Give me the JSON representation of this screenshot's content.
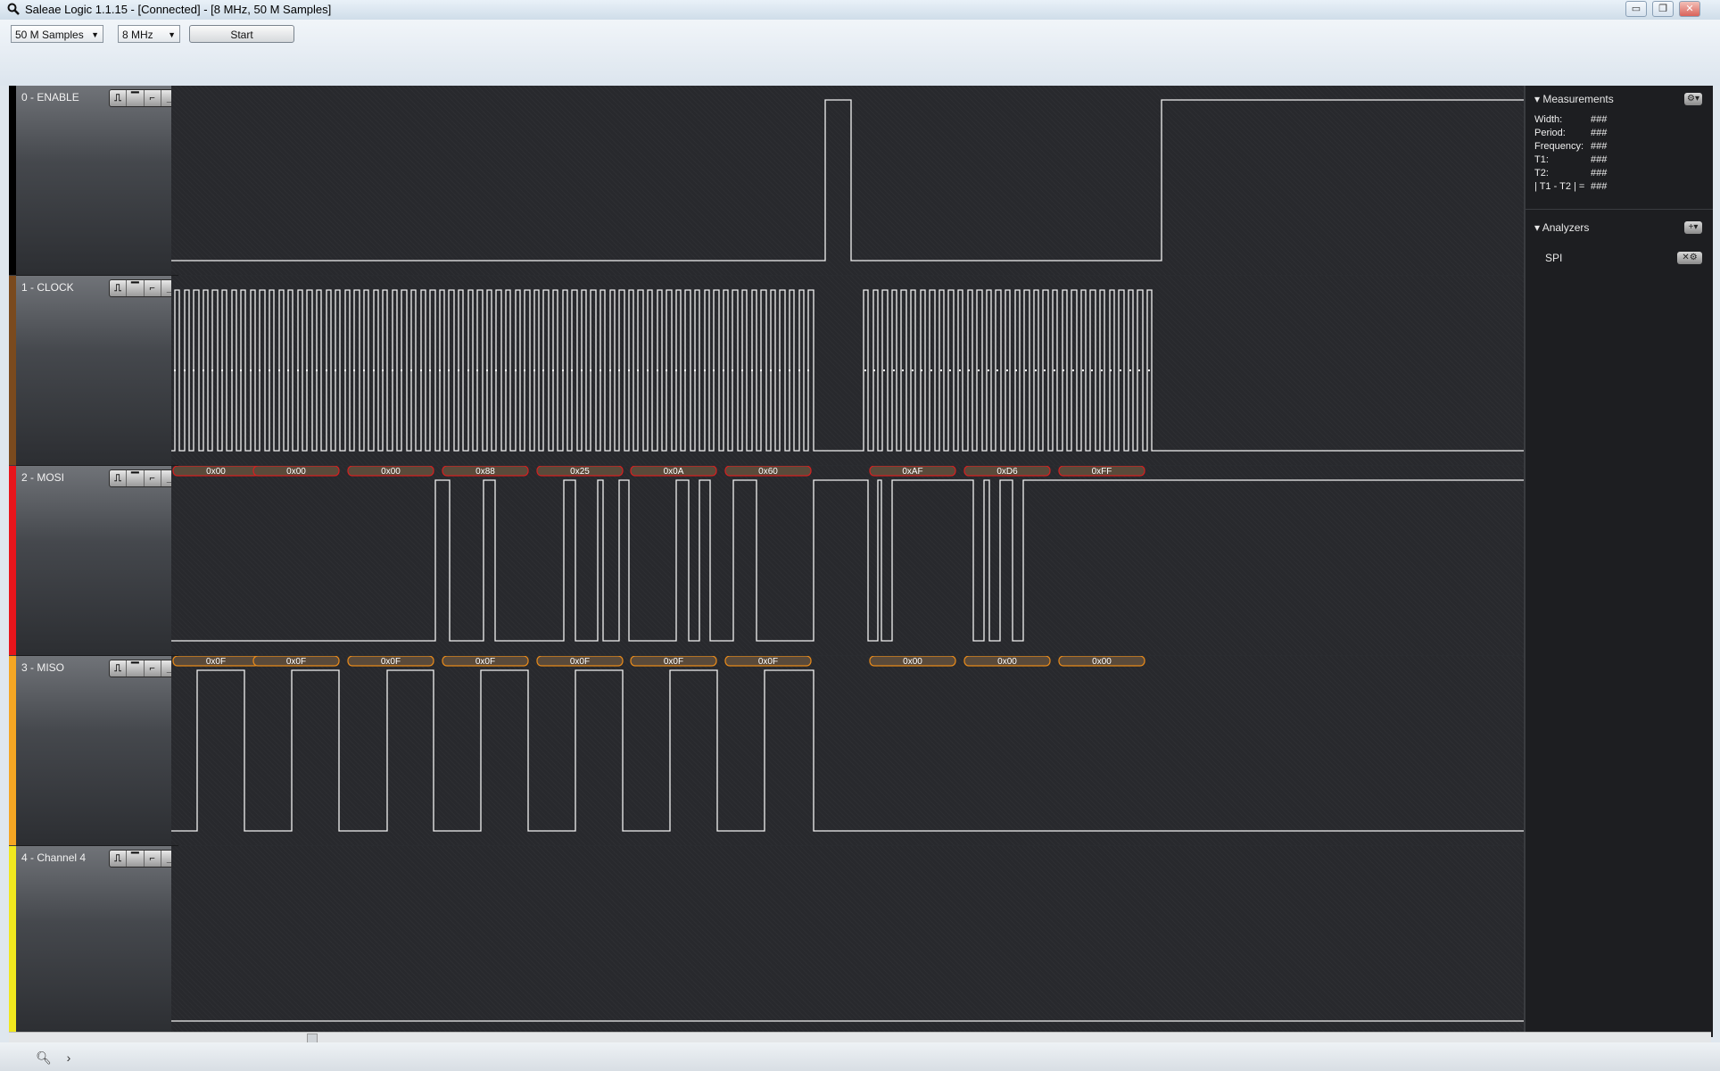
{
  "window": {
    "title": "Saleae Logic 1.1.15 - [Connected] - [8 MHz, 50 M Samples]",
    "minimize": "▭",
    "restore": "❐",
    "close": "✕"
  },
  "toolbar": {
    "samples": "50 M Samples",
    "rate": "8 MHz",
    "start_label": "Start"
  },
  "channels": [
    {
      "name": "0 - ENABLE",
      "color": "#000000"
    },
    {
      "name": "1 - CLOCK",
      "color": "#7a4a1e"
    },
    {
      "name": "2 - MOSI",
      "color": "#e8151b"
    },
    {
      "name": "3 - MISO",
      "color": "#f5a623"
    },
    {
      "name": "4 - Channel 4",
      "color": "#f1e81e"
    }
  ],
  "channel_buttons": [
    "⎍",
    "▔",
    "⌐",
    "_"
  ],
  "mosi_bytes": [
    "0x00",
    "0x00",
    "0x00",
    "0x88",
    "0x25",
    "0x0A",
    "0x60",
    "0xAF",
    "0xD6",
    "0xFF"
  ],
  "miso_bytes": [
    "0x0F",
    "0x0F",
    "0x0F",
    "0x0F",
    "0x0F",
    "0x0F",
    "0x0F",
    "0x00",
    "0x00",
    "0x00"
  ],
  "measurements": {
    "header": "Measurements",
    "rows": [
      {
        "label": "Width:",
        "value": "###"
      },
      {
        "label": "Period:",
        "value": "###"
      },
      {
        "label": "Frequency:",
        "value": "###"
      },
      {
        "label": "T1:",
        "value": "###"
      },
      {
        "label": "T2:",
        "value": "###"
      },
      {
        "label": "| T1 - T2 | =",
        "value": "###"
      }
    ]
  },
  "analyzers": {
    "header": "Analyzers",
    "items": [
      "SPI"
    ]
  },
  "colors": {
    "mosi_badge_border": "#d42020",
    "miso_badge_border": "#e88a1a",
    "trace": "#f2f2f2"
  }
}
